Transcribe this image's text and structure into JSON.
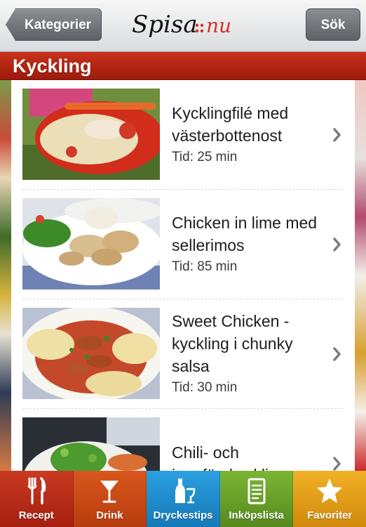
{
  "navbar": {
    "back_label": "Kategorier",
    "search_label": "Sök",
    "logo_text": "Spisa",
    "logo_suffix": "nu"
  },
  "category": {
    "title": "Kyckling"
  },
  "recipes": [
    {
      "title": "Kycklingfilé med västerbottenost",
      "time": "Tid: 25 min"
    },
    {
      "title": "Chicken in lime med sellerimos",
      "time": "Tid: 85 min"
    },
    {
      "title": "Sweet Chicken - kyckling i chunky salsa",
      "time": "Tid: 30 min"
    },
    {
      "title": "Chili- och ingefärskyckling",
      "time": ""
    }
  ],
  "tabs": [
    {
      "label": "Recept",
      "icon": "fork-knife-icon",
      "color": "#b92a17"
    },
    {
      "label": "Drink",
      "icon": "cocktail-glass-icon",
      "color": "#cd4a12"
    },
    {
      "label": "Dryckestips",
      "icon": "bottle-glass-icon",
      "color": "#1f8fd0"
    },
    {
      "label": "Inköpslista",
      "icon": "shopping-list-icon",
      "color": "#6aa02a"
    },
    {
      "label": "Favoriter",
      "icon": "star-icon",
      "color": "#e6a118"
    }
  ]
}
